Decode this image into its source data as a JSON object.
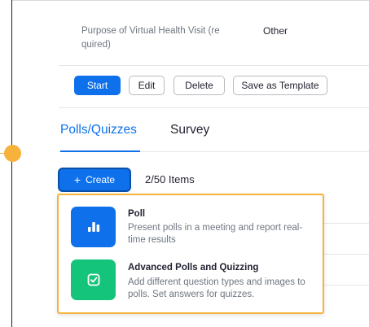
{
  "field": {
    "label": "Purpose of Virtual Health Visit (re quired)",
    "value": "Other"
  },
  "actions": {
    "start": "Start",
    "edit": "Edit",
    "delete": "Delete",
    "save_template": "Save as Template"
  },
  "tabs": [
    {
      "label": "Polls/Quizzes",
      "active": true
    },
    {
      "label": "Survey",
      "active": false
    }
  ],
  "create": {
    "icon": "plus-icon",
    "label": "Create"
  },
  "items_count": "2/50 Items",
  "menu": {
    "options": [
      {
        "title": "Poll",
        "description": "Present polls in a meeting and report real-time results",
        "icon": "bar-chart-icon",
        "color": "#0e71eb"
      },
      {
        "title": "Advanced Polls and Quizzing",
        "description": "Add different question types and images to polls. Set answers for quizzes.",
        "icon": "check-square-icon",
        "color": "#14c47a"
      }
    ]
  },
  "colors": {
    "accent": "#0e71eb",
    "highlight": "#f7b23b"
  }
}
